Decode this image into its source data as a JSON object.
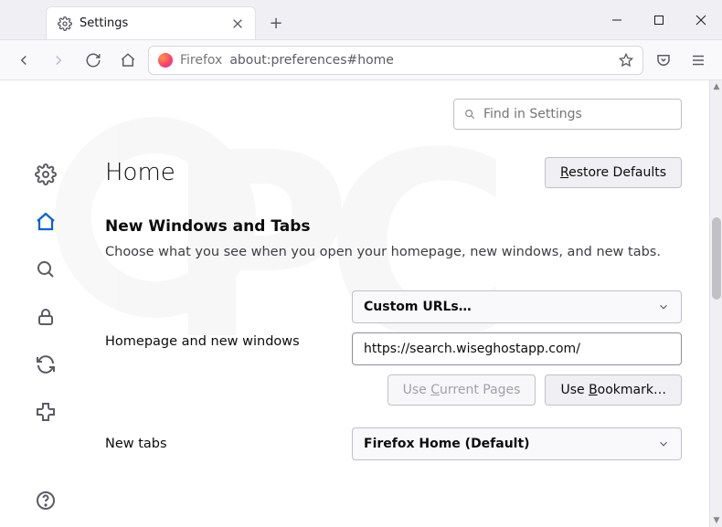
{
  "tab": {
    "title": "Settings"
  },
  "urlbar": {
    "browser_label": "Firefox",
    "url": "about:preferences#home"
  },
  "search": {
    "placeholder": "Find in Settings"
  },
  "page": {
    "heading": "Home",
    "restore_btn": "Restore Defaults",
    "section_title": "New Windows and Tabs",
    "section_desc": "Choose what you see when you open your homepage, new windows, and new tabs."
  },
  "homepage": {
    "label": "Homepage and new windows",
    "dropdown": "Custom URLs…",
    "url_value": "https://search.wiseghostapp.com/",
    "use_current": "Use Current Pages",
    "use_bookmark": "Use Bookmark…"
  },
  "newtabs": {
    "label": "New tabs",
    "dropdown": "Firefox Home (Default)"
  }
}
